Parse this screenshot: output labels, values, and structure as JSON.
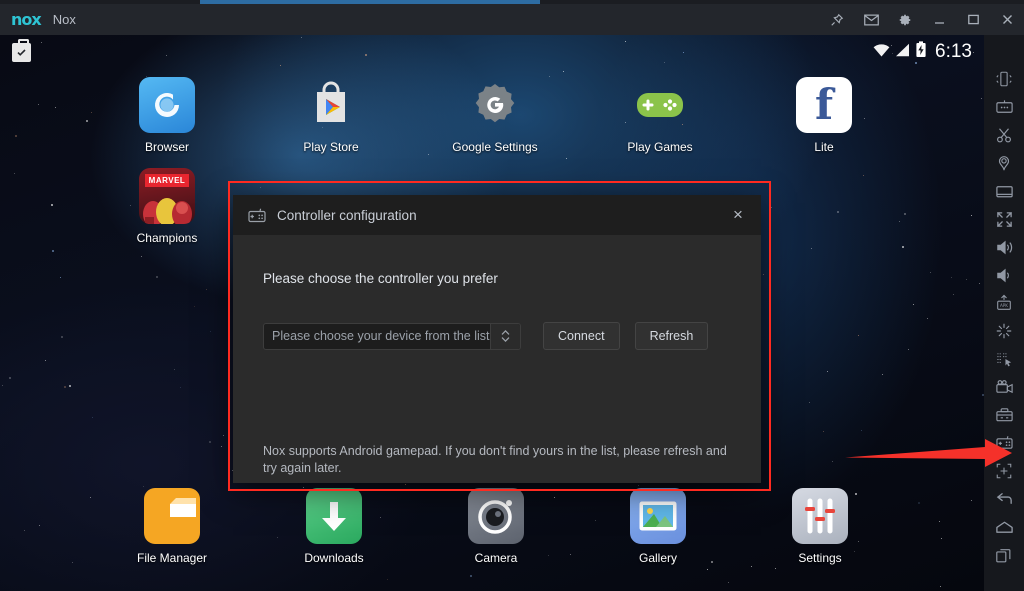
{
  "window": {
    "app_logo": "nox",
    "title": "Nox",
    "controls": [
      {
        "name": "pin-icon",
        "label": "Pin"
      },
      {
        "name": "mail-icon",
        "label": "Messages"
      },
      {
        "name": "gear-icon",
        "label": "Settings"
      },
      {
        "name": "minimize-icon",
        "label": "Minimize"
      },
      {
        "name": "maximize-icon",
        "label": "Maximize"
      },
      {
        "name": "close-icon",
        "label": "Close"
      }
    ]
  },
  "statusbar": {
    "work_profile_icon": "briefcase-check-icon",
    "wifi_icon": "wifi-icon",
    "signal_icon": "cell-signal-icon",
    "battery_icon": "battery-charging-icon",
    "clock": "6:13"
  },
  "home": {
    "apps": [
      {
        "label": "Browser",
        "icon": "browser-icon"
      },
      {
        "label": "Play Store",
        "icon": "play-store-icon"
      },
      {
        "label": "Google Settings",
        "icon": "google-settings-icon"
      },
      {
        "label": "Play Games",
        "icon": "play-games-icon"
      },
      {
        "label": "Lite",
        "icon": "facebook-lite-icon"
      },
      {
        "label": "Champions",
        "icon": "marvel-champions-icon"
      },
      {
        "label": "File Manager",
        "icon": "file-manager-icon"
      },
      {
        "label": "Downloads",
        "icon": "downloads-icon"
      },
      {
        "label": "Camera",
        "icon": "camera-icon"
      },
      {
        "label": "Gallery",
        "icon": "gallery-icon"
      },
      {
        "label": "Settings",
        "icon": "settings-icon"
      }
    ],
    "marvel_badge": "MARVEL",
    "page_indicator": "page-dot"
  },
  "dialog": {
    "icon": "gamepad-config-icon",
    "title": "Controller configuration",
    "close_label": "×",
    "prompt": "Please choose the controller you prefer",
    "select": {
      "value": "Please choose your device from the list",
      "spinner_icon": "chevron-updown-icon"
    },
    "connect_label": "Connect",
    "refresh_label": "Refresh",
    "note": "Nox supports Android gamepad. If you don't find yours in the list, please refresh and try again later."
  },
  "toolbar": {
    "items": [
      {
        "name": "shake-phone-icon",
        "label": "Shake"
      },
      {
        "name": "keyboard-macro-icon",
        "label": "Keyboard control"
      },
      {
        "name": "scissors-icon",
        "label": "Screenshot"
      },
      {
        "name": "location-icon",
        "label": "Location"
      },
      {
        "name": "fullscreen-window-icon",
        "label": "Window"
      },
      {
        "name": "expand-icon",
        "label": "Fullscreen"
      },
      {
        "name": "volume-up-icon",
        "label": "Volume up"
      },
      {
        "name": "volume-down-icon",
        "label": "Volume down"
      },
      {
        "name": "apk-install-icon",
        "label": "Install APK"
      },
      {
        "name": "shake-burst-icon",
        "label": "Shake effect"
      },
      {
        "name": "script-record-icon",
        "label": "Script recorder"
      },
      {
        "name": "video-record-icon",
        "label": "Record screen"
      },
      {
        "name": "multi-instance-icon",
        "label": "Multi instance"
      },
      {
        "name": "gamepad-icon",
        "label": "Controller configuration"
      },
      {
        "name": "add-widget-icon",
        "label": "Add"
      },
      {
        "name": "back-icon",
        "label": "Back"
      },
      {
        "name": "home-icon",
        "label": "Home"
      },
      {
        "name": "recents-icon",
        "label": "Recent apps"
      }
    ]
  },
  "annotations": {
    "highlight_rect_color": "#ff2a20",
    "arrow_color": "#f5312a",
    "arrow_points_to": "gamepad-icon"
  }
}
